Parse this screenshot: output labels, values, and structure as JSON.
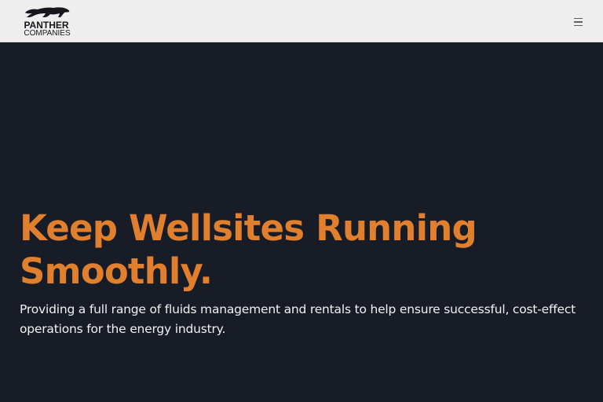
{
  "header": {
    "logo": {
      "line1": "PANTHER",
      "line2": "COMPANIES",
      "icon": "panther-icon"
    },
    "menu_icon": "hamburger-menu-icon"
  },
  "hero": {
    "title_line1": "Keep Wellsites Running",
    "title_line2": "Smoothly.",
    "subtitle_line1": "Providing a full range of fluids management and rentals to help ensure successful, cost-effect",
    "subtitle_line2": "operations for the energy industry."
  },
  "colors": {
    "header_bg": "#eeeeee",
    "hero_bg": "#181c26",
    "accent": "#e07f2d",
    "text_light": "#f2f2f2",
    "logo_dark": "#15171c"
  }
}
